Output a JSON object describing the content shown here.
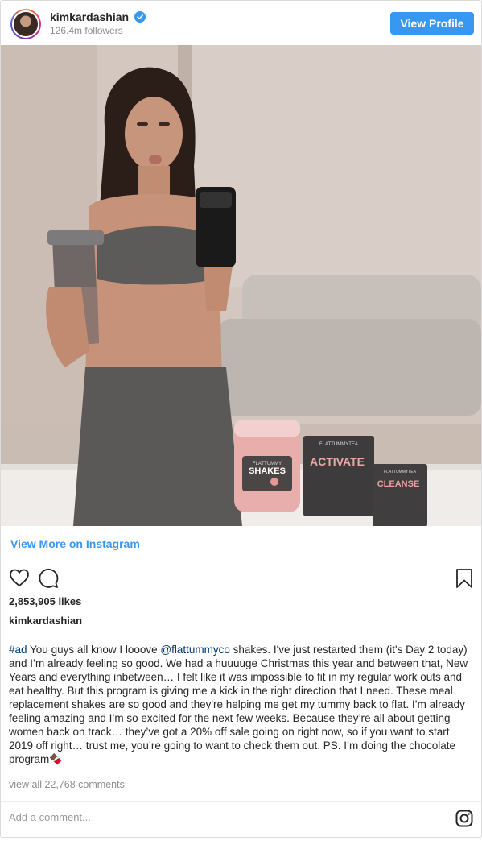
{
  "header": {
    "username": "kimkardashian",
    "followers": "126.4m followers",
    "view_profile_label": "View Profile"
  },
  "post": {
    "view_more_label": "View More on Instagram",
    "likes": "2,853,905 likes",
    "caption_user": "kimkardashian",
    "caption": {
      "hashtag": "#ad",
      "part1": " You guys all know I looove ",
      "mention": "@flattummyco",
      "part2": " shakes. I've just restarted them (it's Day 2 today) and I’m already feeling so good. We had a huuuuge Christmas this year and between that, New Years and everything inbetween… I felt like it was impossible to fit in my regular work outs and eat healthy. But this program is giving me a kick in the right direction that I need. These meal replacement shakes are so good and they're helping me get my tummy back to flat. I’m already feeling amazing and I’m so excited for the next few weeks. Because they’re all about getting women back on track… they’ve got a 20% off sale going on right now, so if you want to start 2019 off right… trust me, you’re going to want to check them out. PS. I’m doing the chocolate program🍫"
    },
    "view_comments_label": "view all 22,768 comments",
    "add_comment_placeholder": "Add a comment...",
    "photo_text": {
      "shakes_brand": "FLATTUMMY",
      "shakes_label": "SHAKES",
      "activate_brand": "FLATTUMMYTEA",
      "activate_label": "ACTIVATE",
      "cleanse_brand": "FLATTUMMYTEA",
      "cleanse_label": "CLEANSE"
    }
  },
  "icons": {
    "heart": "heart-icon",
    "comment": "comment-icon",
    "bookmark": "bookmark-icon",
    "verified": "verified-badge-icon",
    "instagram": "instagram-icon"
  },
  "colors": {
    "accent": "#3897f0",
    "link": "#003569",
    "muted": "#8e8e8e"
  }
}
